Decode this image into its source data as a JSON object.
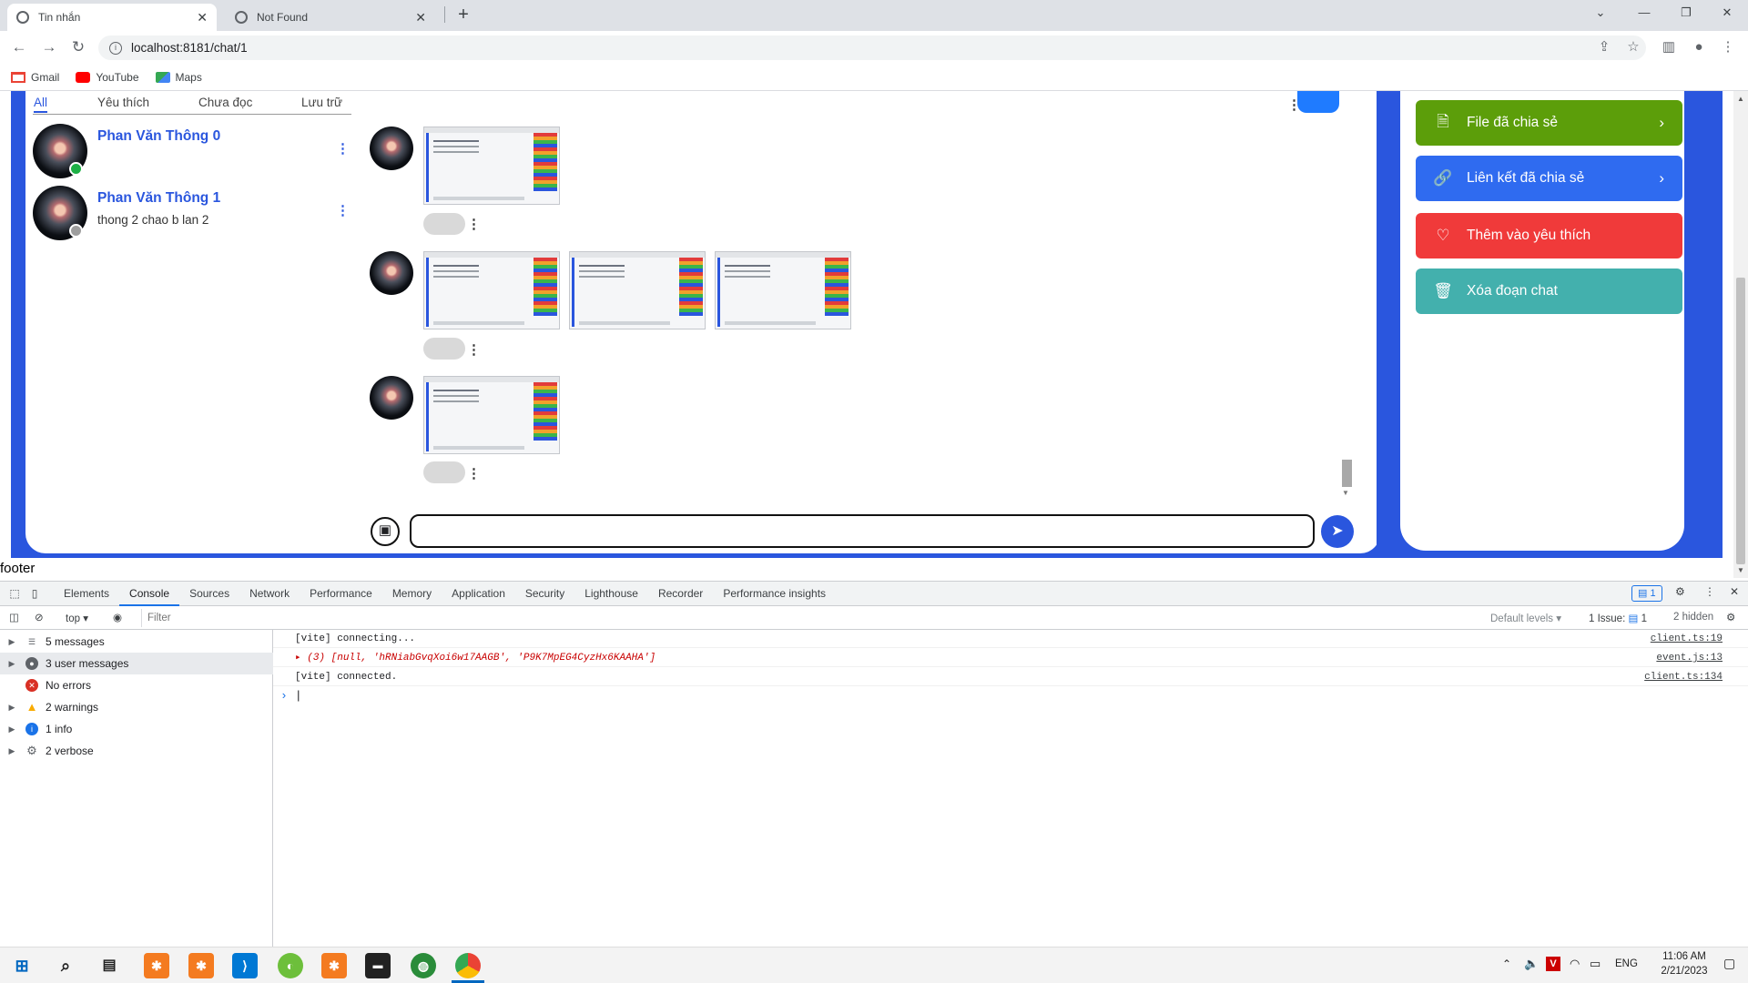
{
  "browser": {
    "tabs": [
      {
        "title": "Tin nhắn",
        "active": true
      },
      {
        "title": "Not Found",
        "active": false
      }
    ],
    "url": "localhost:8181/chat/1",
    "bookmarks": [
      "Gmail",
      "YouTube",
      "Maps"
    ]
  },
  "chat": {
    "filter_tabs": [
      "All",
      "Yêu thích",
      "Chưa đọc",
      "Lưu trữ"
    ],
    "active_filter": "All",
    "conversations": [
      {
        "name": "Phan Văn Thông 0",
        "preview": "",
        "online": true
      },
      {
        "name": "Phan Văn Thông 1",
        "preview": "thong 2 chao b lan 2",
        "online": false
      }
    ],
    "message_input": {
      "value": ""
    }
  },
  "sidebar_actions": [
    {
      "label": "File đã chia sẻ",
      "icon": "file-image-icon",
      "color": "#5c9e0a"
    },
    {
      "label": "Liên kết đã chia sẻ",
      "icon": "link-icon",
      "color": "#2f6bf0"
    },
    {
      "label": "Thêm vào yêu thích",
      "icon": "heart-icon",
      "color": "#f03a3a"
    },
    {
      "label": "Xóa đoạn chat",
      "icon": "trash-icon",
      "color": "#43b0ad"
    }
  ],
  "footer_label": "footer",
  "devtools": {
    "tabs": [
      "Elements",
      "Console",
      "Sources",
      "Network",
      "Performance",
      "Memory",
      "Application",
      "Security",
      "Lighthouse",
      "Recorder",
      "Performance insights"
    ],
    "active_tab": "Console",
    "issues_badge": "1",
    "context": "top",
    "filter_placeholder": "Filter",
    "default_levels": "Default levels ▾",
    "issues_count": "1 Issue:",
    "issues_num": "1",
    "hidden": "2 hidden",
    "sidebar": [
      {
        "label": "5 messages",
        "icon": "list-icon"
      },
      {
        "label": "3 user messages",
        "icon": "user-icon"
      },
      {
        "label": "No errors",
        "icon": "error-icon"
      },
      {
        "label": "2 warnings",
        "icon": "warning-icon"
      },
      {
        "label": "1 info",
        "icon": "info-icon"
      },
      {
        "label": "2 verbose",
        "icon": "verbose-icon"
      }
    ],
    "console_lines": [
      {
        "text": "[vite] connecting...",
        "source": "client.ts:19"
      },
      {
        "text": "▸ (3) [null, 'hRNiabGvqXoi6w17AAGB', 'P9K7MpEG4CyzHx6KAAHA']",
        "source": "event.js:13"
      },
      {
        "text": "[vite] connected.",
        "source": "client.ts:134"
      }
    ],
    "prompt": "›"
  },
  "taskbar": {
    "language": "ENG",
    "time": "11:06 AM",
    "date": "2/21/2023"
  }
}
